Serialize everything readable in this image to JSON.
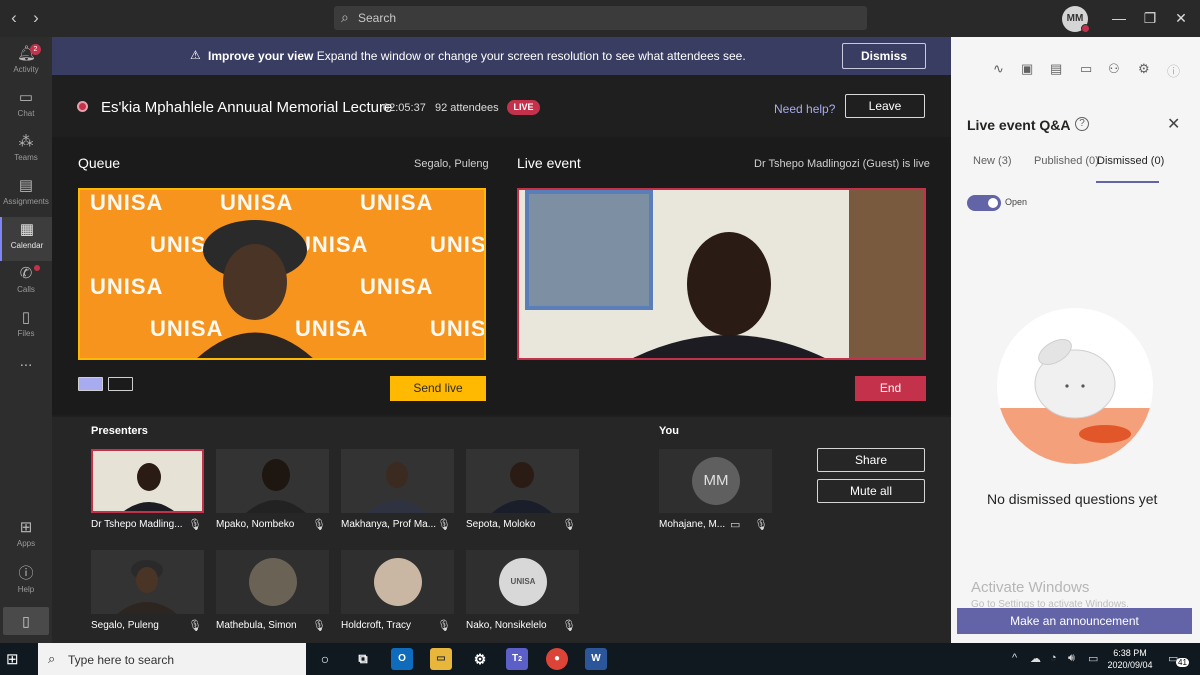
{
  "titlebar": {
    "search_placeholder": "Search",
    "avatar_initials": "MM"
  },
  "rail": {
    "items": [
      {
        "label": "Activity",
        "badge": "2"
      },
      {
        "label": "Chat"
      },
      {
        "label": "Teams"
      },
      {
        "label": "Assignments"
      },
      {
        "label": "Calendar"
      },
      {
        "label": "Calls"
      },
      {
        "label": "Files"
      },
      {
        "label": "..."
      },
      {
        "label": "Apps"
      },
      {
        "label": "Help"
      }
    ]
  },
  "banner": {
    "bold": "Improve your view",
    "text": "Expand the window or change your screen resolution to see what attendees see.",
    "dismiss": "Dismiss"
  },
  "event": {
    "title": "Es'kia Mphahlele Annuual Memorial Lecture",
    "elapsed": "02:05:37",
    "attendees": "92 attendees",
    "live": "LIVE",
    "need_help": "Need help?",
    "leave": "Leave"
  },
  "queue": {
    "label": "Queue",
    "presenter": "Segalo, Puleng",
    "send_live": "Send live",
    "background_word": "UNISA"
  },
  "live_event": {
    "label": "Live event",
    "status": "Dr Tshepo Madlingozi (Guest) is live",
    "end": "End"
  },
  "presenters": {
    "label": "Presenters",
    "tiles": [
      {
        "name": "Dr Tshepo Madling...",
        "kind": "office",
        "mic": "on",
        "selected": true
      },
      {
        "name": "Mpako, Nombeko",
        "kind": "unisa",
        "mic": "off"
      },
      {
        "name": "Makhanya, Prof Ma...",
        "kind": "unisa",
        "mic": "off"
      },
      {
        "name": "Sepota, Moloko",
        "kind": "unisa",
        "mic": "off"
      },
      {
        "name": "Segalo, Puleng",
        "kind": "unisa",
        "mic": "on"
      },
      {
        "name": "Mathebula, Simon",
        "kind": "avatar",
        "mic": "off"
      },
      {
        "name": "Holdcroft, Tracy",
        "kind": "avatar",
        "mic": "off"
      },
      {
        "name": "Nako, Nonsikelelo",
        "kind": "logo",
        "mic": "off"
      }
    ]
  },
  "you": {
    "label": "You",
    "initials": "MM",
    "name": "Mohajane, M...",
    "share": "Share",
    "mute_all": "Mute all"
  },
  "qa": {
    "title": "Live event Q&A",
    "tabs": [
      "New (3)",
      "Published (0)",
      "Dismissed (0)"
    ],
    "active_tab": 2,
    "toggle_label": "Open",
    "empty": "No dismissed questions yet",
    "watermark_title": "Activate Windows",
    "watermark_sub": "Go to Settings to activate Windows.",
    "announce": "Make an announcement"
  },
  "taskbar": {
    "search_placeholder": "Type here to search",
    "time": "6:38 PM",
    "date": "2020/09/04",
    "notifications": "41",
    "teams_badge": "2"
  },
  "colors": {
    "accent": "#6264a7",
    "live_red": "#c4314b",
    "send_live_yellow": "#ffb900",
    "unisa_orange": "#f7941d"
  }
}
